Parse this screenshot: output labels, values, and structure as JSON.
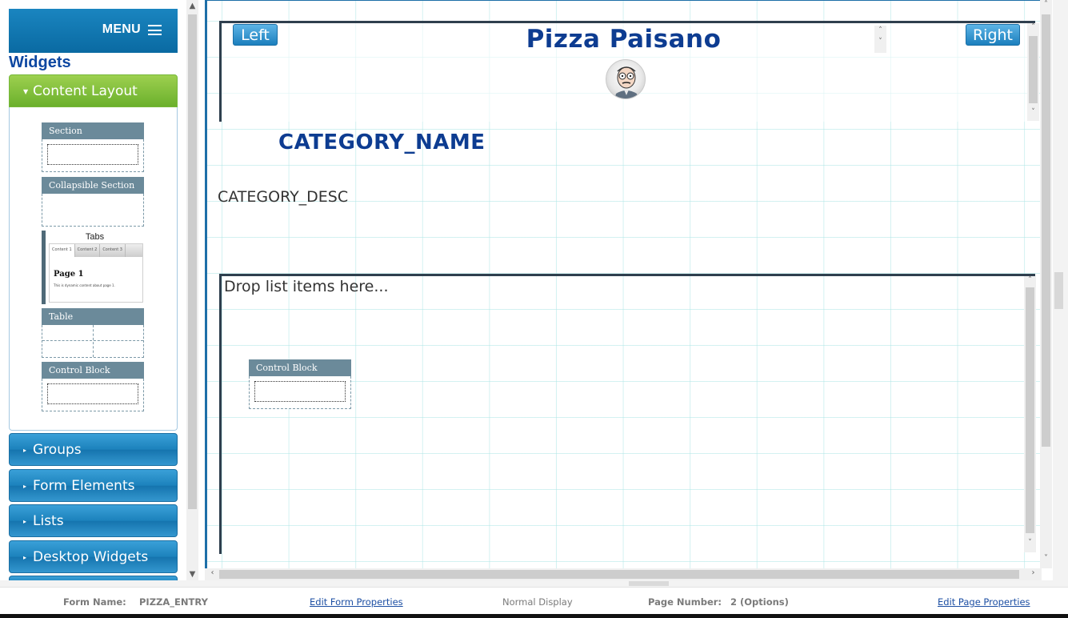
{
  "sidebar": {
    "menu_label": "MENU",
    "title": "Widgets",
    "active_section": "Content Layout",
    "widgets": {
      "section": "Section",
      "collapsible_section": "Collapsible Section",
      "tabs": "Tabs",
      "tabs_preview": {
        "tab1": "Content 1",
        "tab2": "Content 2",
        "tab3": "Content 3",
        "page": "Page 1",
        "text": "This is dynamic content about page 1."
      },
      "table": "Table",
      "control_block": "Control Block"
    },
    "collapsed_sections": [
      "Groups",
      "Form Elements",
      "Lists",
      "Desktop Widgets"
    ]
  },
  "canvas": {
    "left_button": "Left",
    "right_button": "Right",
    "title": "Pizza Paisano",
    "category_name": "CATEGORY_NAME",
    "category_desc": "CATEGORY_DESC",
    "drop_placeholder": "Drop list items here...",
    "control_block": "Control Block"
  },
  "footer": {
    "form_name_label": "Form Name:",
    "form_name_value": "PIZZA_ENTRY",
    "edit_form_link": "Edit Form Properties",
    "display_mode": "Normal Display",
    "page_number_label": "Page Number:",
    "page_number_value": "2 (Options)",
    "edit_page_link": "Edit Page Properties"
  },
  "colors": {
    "accent_blue": "#1a7cb8",
    "active_green": "#7dbb3a",
    "title_blue": "#0d3c91"
  }
}
